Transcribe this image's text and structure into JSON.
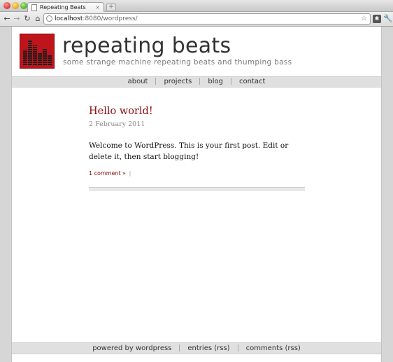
{
  "browser": {
    "tab_title": "Repeating Beats",
    "tab_close": "×",
    "new_tab": "+",
    "url_host": "localhost",
    "url_path": ":8080/wordpress/",
    "icons": [
      "back-arrow-icon",
      "forward-arrow-icon",
      "reload-icon",
      "home-icon",
      "globe-icon",
      "star-icon",
      "extension-icon",
      "wrench-icon"
    ]
  },
  "site": {
    "title": "repeating beats",
    "description": "some strange machine repeating beats and thumping bass",
    "logo_color": "#c0141c"
  },
  "nav": {
    "items": [
      {
        "label": "about"
      },
      {
        "label": "projects"
      },
      {
        "label": "blog"
      },
      {
        "label": "contact"
      }
    ]
  },
  "post": {
    "title": "Hello world!",
    "date": "2 February 2011",
    "body": "Welcome to WordPress. This is your first post. Edit or delete it, then start blogging!",
    "comments_link": "1 comment »",
    "meta_separator": "|"
  },
  "footer": {
    "items": [
      {
        "label": "powered by wordpress"
      },
      {
        "label": "entries (rss)"
      },
      {
        "label": "comments (rss)"
      }
    ]
  }
}
